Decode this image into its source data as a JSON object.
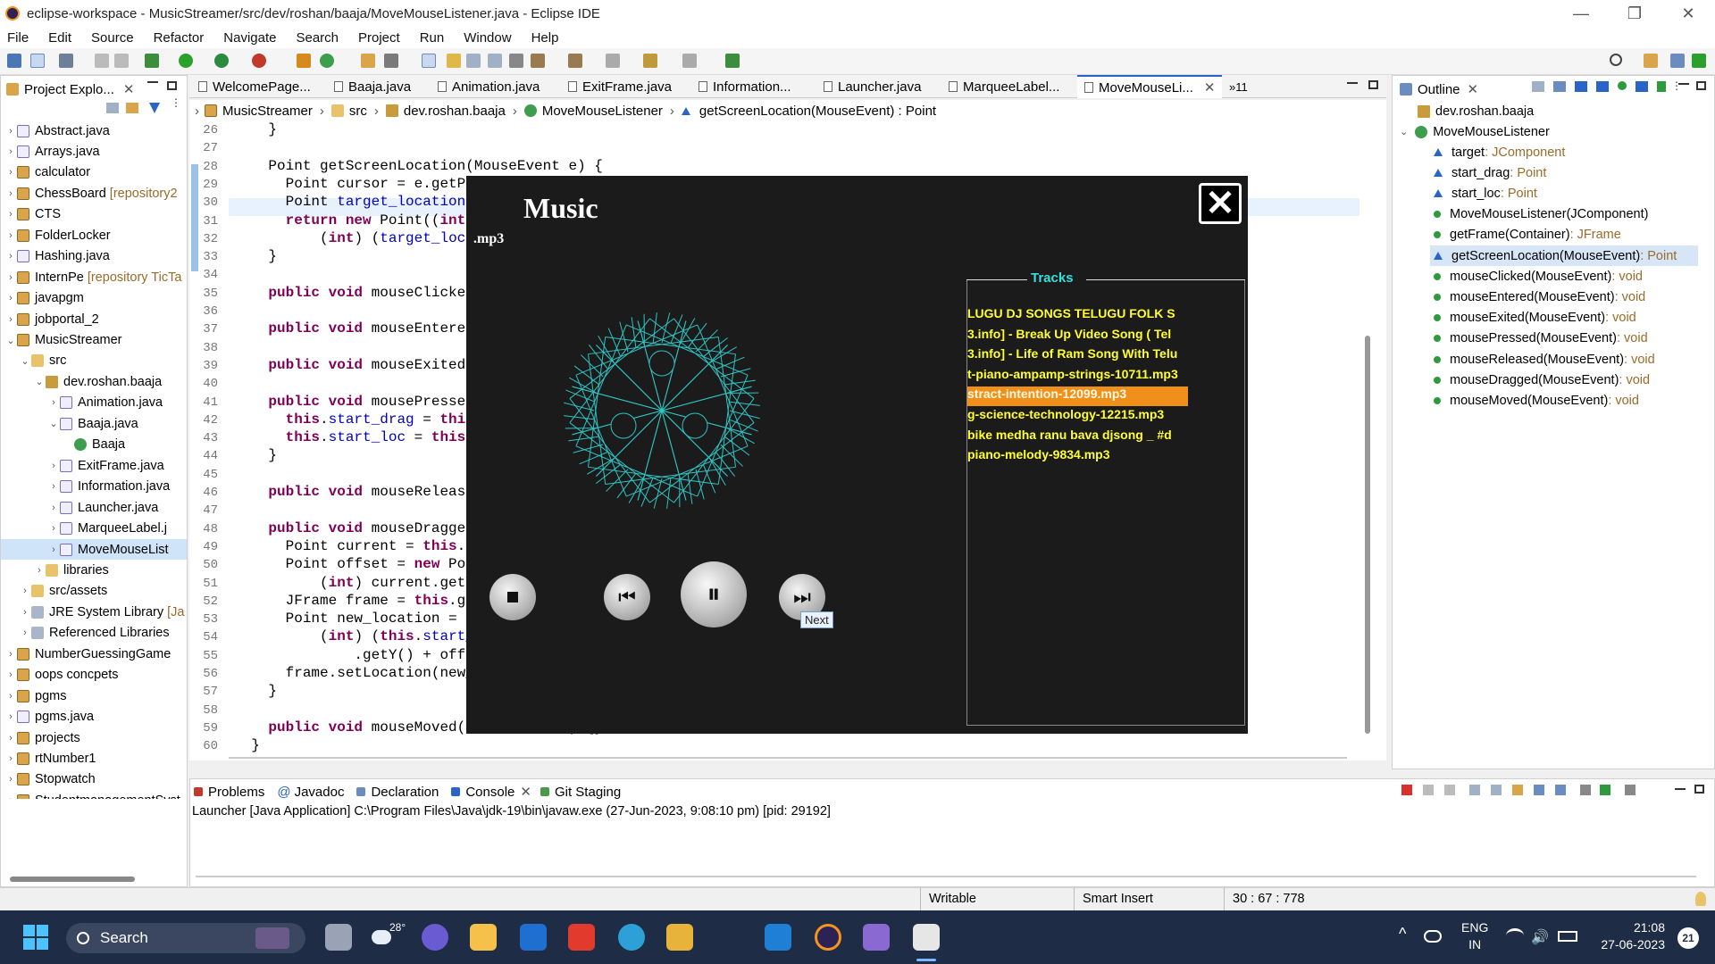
{
  "window": {
    "title": "eclipse-workspace - MusicStreamer/src/dev/roshan/baaja/MoveMouseListener.java - Eclipse IDE"
  },
  "menu": [
    "File",
    "Edit",
    "Source",
    "Refactor",
    "Navigate",
    "Search",
    "Project",
    "Run",
    "Window",
    "Help"
  ],
  "explorer": {
    "title": "Project Explo...",
    "items": [
      {
        "label": "Abstract.java",
        "icon": "java-file-icon",
        "level": 0
      },
      {
        "label": "Arrays.java",
        "icon": "java-file-icon",
        "level": 0
      },
      {
        "label": "calculator",
        "icon": "project-icon",
        "level": 0
      },
      {
        "label": "ChessBoard",
        "suffix": "[repository2",
        "icon": "project-icon",
        "level": 0
      },
      {
        "label": "CTS",
        "icon": "project-icon",
        "level": 0
      },
      {
        "label": "FolderLocker",
        "icon": "project-icon",
        "level": 0
      },
      {
        "label": "Hashing.java",
        "icon": "java-file-icon",
        "level": 0
      },
      {
        "label": "InternPe",
        "suffix": "[repository TicTa",
        "icon": "project-icon",
        "level": 0
      },
      {
        "label": "javapgm",
        "icon": "project-icon",
        "level": 0
      },
      {
        "label": "jobportal_2",
        "icon": "project-icon",
        "level": 0
      },
      {
        "label": "MusicStreamer",
        "icon": "project-icon",
        "level": 0,
        "open": true
      },
      {
        "label": "src",
        "icon": "source-folder-icon",
        "level": 1,
        "open": true
      },
      {
        "label": "dev.roshan.baaja",
        "icon": "package-icon",
        "level": 2,
        "open": true
      },
      {
        "label": "Animation.java",
        "icon": "java-file-icon",
        "level": 3
      },
      {
        "label": "Baaja.java",
        "icon": "java-file-icon",
        "level": 3,
        "open": true
      },
      {
        "label": "Baaja",
        "icon": "class-icon",
        "level": 4
      },
      {
        "label": "ExitFrame.java",
        "icon": "java-file-icon",
        "level": 3
      },
      {
        "label": "Information.java",
        "icon": "java-file-icon",
        "level": 3
      },
      {
        "label": "Launcher.java",
        "icon": "java-file-icon",
        "level": 3
      },
      {
        "label": "MarqueeLabel.j",
        "icon": "java-file-icon",
        "level": 3
      },
      {
        "label": "MoveMouseList",
        "icon": "java-file-icon",
        "level": 3,
        "selected": true
      },
      {
        "label": "libraries",
        "icon": "folder-icon",
        "level": 2
      },
      {
        "label": "src/assets",
        "icon": "source-folder-icon",
        "level": 1
      },
      {
        "label": "JRE System Library",
        "suffix": "[Ja",
        "icon": "library-icon",
        "level": 1
      },
      {
        "label": "Referenced Libraries",
        "icon": "library-icon",
        "level": 1
      },
      {
        "label": "NumberGuessingGame",
        "icon": "project-icon",
        "level": 0
      },
      {
        "label": "oops concpets",
        "icon": "project-icon",
        "level": 0
      },
      {
        "label": "pgms",
        "icon": "project-icon",
        "level": 0
      },
      {
        "label": "pgms.java",
        "icon": "java-file-icon",
        "level": 0
      },
      {
        "label": "projects",
        "icon": "project-icon",
        "level": 0
      },
      {
        "label": "rtNumber1",
        "icon": "project-icon",
        "level": 0
      },
      {
        "label": "Stopwatch",
        "icon": "project-icon",
        "level": 0
      },
      {
        "label": "StudentmanagementSyst",
        "icon": "project-icon",
        "level": 0
      },
      {
        "label": "TimerStopwatch",
        "icon": "project-icon",
        "level": 0
      },
      {
        "label": "VarargExample",
        "icon": "project-icon",
        "level": 0
      },
      {
        "label": "varargs",
        "icon": "project-icon",
        "level": 0
      }
    ]
  },
  "editor_tabs": [
    "WelcomePage...",
    "Baaja.java",
    "Animation.java",
    "ExitFrame.java",
    "Information...",
    "Launcher.java",
    "MarqueeLabel...",
    "MoveMouseLi..."
  ],
  "editor_tab_overflow": "»11",
  "breadcrumb": [
    "MusicStreamer",
    "src",
    "dev.roshan.baaja",
    "MoveMouseListener",
    "getScreenLocation(MouseEvent) : Point"
  ],
  "code": [
    {
      "n": "26",
      "t": "    }"
    },
    {
      "n": "27",
      "t": ""
    },
    {
      "n": "28",
      "t": "    Point getScreenLocation(MouseEvent e) {"
    },
    {
      "n": "29",
      "t": "      Point cursor = e.getPoint();"
    },
    {
      "n": "30",
      "t": "      Point target_location = this.target.getLocationOnScreen();"
    },
    {
      "n": "31",
      "t": "      return new Point((int) (target_location.getX() + cursor.getX()),"
    },
    {
      "n": "32",
      "t": "          (int) (target_location.getY() + cursor.getY()));"
    },
    {
      "n": "33",
      "t": "    }"
    },
    {
      "n": "34",
      "t": ""
    },
    {
      "n": "35",
      "t": "    public void mouseClicked(MouseEvent e) {}"
    },
    {
      "n": "36",
      "t": ""
    },
    {
      "n": "37",
      "t": "    public void mouseEntered(MouseEvent e) {}"
    },
    {
      "n": "38",
      "t": ""
    },
    {
      "n": "39",
      "t": "    public void mouseExited(MouseEvent e) {}"
    },
    {
      "n": "40",
      "t": ""
    },
    {
      "n": "41",
      "t": "    public void mousePressed(MouseEvent e) {"
    },
    {
      "n": "42",
      "t": "      this.start_drag = this.getScreenLocation(e);"
    },
    {
      "n": "43",
      "t": "      this.start_loc = this.getFrame(this.target).getLocation();"
    },
    {
      "n": "44",
      "t": "    }"
    },
    {
      "n": "45",
      "t": ""
    },
    {
      "n": "46",
      "t": "    public void mouseReleased(MouseEvent e) {}"
    },
    {
      "n": "47",
      "t": ""
    },
    {
      "n": "48",
      "t": "    public void mouseDragged(MouseEvent e) {"
    },
    {
      "n": "49",
      "t": "      Point current = this.getScreenLocation(e);"
    },
    {
      "n": "50",
      "t": "      Point offset = new Point((int) current.getX() - (int) start_drag.getX(),"
    },
    {
      "n": "51",
      "t": "          (int) current.getY() - (int) start_drag.getY());"
    },
    {
      "n": "52",
      "t": "      JFrame frame = this.getFrame(target);"
    },
    {
      "n": "53",
      "t": "      Point new_location = new Point("
    },
    {
      "n": "54",
      "t": "          (int) (this.start_loc.getX() + offset.getX()), (int) (this.start_loc"
    },
    {
      "n": "55",
      "t": "              .getY() + offset.getY()));"
    },
    {
      "n": "56",
      "t": "      frame.setLocation(new_location);"
    },
    {
      "n": "57",
      "t": "    }"
    },
    {
      "n": "58",
      "t": ""
    },
    {
      "n": "59",
      "t": "    public void mouseMoved(MouseEvent e) {}"
    },
    {
      "n": "60",
      "t": "  }"
    }
  ],
  "outline": {
    "title": "Outline",
    "package": "dev.roshan.baaja",
    "class": "MoveMouseListener",
    "members": [
      {
        "name": "target",
        "type": " : JComponent",
        "kind": "field"
      },
      {
        "name": "start_drag",
        "type": " : Point",
        "kind": "field"
      },
      {
        "name": "start_loc",
        "type": " : Point",
        "kind": "field"
      },
      {
        "name": "MoveMouseListener(JComponent)",
        "type": "",
        "kind": "ctor"
      },
      {
        "name": "getFrame(Container)",
        "type": " : JFrame",
        "kind": "method"
      },
      {
        "name": "getScreenLocation(MouseEvent)",
        "type": " : Point",
        "kind": "field",
        "selected": true
      },
      {
        "name": "mouseClicked(MouseEvent)",
        "type": " : void",
        "kind": "method"
      },
      {
        "name": "mouseEntered(MouseEvent)",
        "type": " : void",
        "kind": "method"
      },
      {
        "name": "mouseExited(MouseEvent)",
        "type": " : void",
        "kind": "method"
      },
      {
        "name": "mousePressed(MouseEvent)",
        "type": " : void",
        "kind": "method"
      },
      {
        "name": "mouseReleased(MouseEvent)",
        "type": " : void",
        "kind": "method"
      },
      {
        "name": "mouseDragged(MouseEvent)",
        "type": " : void",
        "kind": "method"
      },
      {
        "name": "mouseMoved(MouseEvent)",
        "type": " : void",
        "kind": "method"
      }
    ]
  },
  "music_player": {
    "title": "Music",
    "now_playing": ".mp3",
    "tracks_label": "Tracks",
    "tracks": [
      "LUGU DJ SONGS TELUGU FOLK S",
      "3.info] - Break Up Video Song ( Tel",
      "3.info] - Life of Ram Song With Telu",
      "t-piano-ampamp-strings-10711.mp3",
      "stract-intention-12099.mp3",
      "g-science-technology-12215.mp3",
      " bike medha ranu bava djsong _ #d",
      "piano-melody-9834.mp3"
    ],
    "selected_index": 4,
    "tooltip": "Next",
    "colors": {
      "bg": "#1b1b1b",
      "track": "#ffff33",
      "selected": "#f0901a",
      "accent": "#33e0e0"
    }
  },
  "bottom_tabs": [
    "Problems",
    "Javadoc",
    "Declaration",
    "Console",
    "Git Staging"
  ],
  "console": {
    "header": "Launcher [Java Application] C:\\Program Files\\Java\\jdk-19\\bin\\javaw.exe  (27-Jun-2023, 9:08:10 pm) [pid: 29192]"
  },
  "status": {
    "writable": "Writable",
    "insert": "Smart Insert",
    "position": "30 : 67 : 778"
  },
  "taskbar": {
    "search": "Search",
    "weather": "28°",
    "lang1": "ENG",
    "lang2": "IN",
    "time": "21:08",
    "date": "27-06-2023",
    "badge": "21"
  }
}
